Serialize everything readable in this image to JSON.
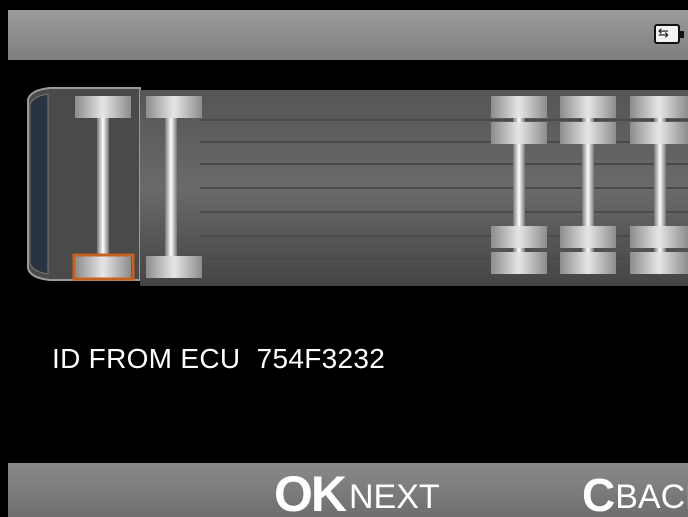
{
  "header": {
    "battery_icon": "battery-icon"
  },
  "vehicle": {
    "diagram": "truck-top-view",
    "selected_wheel": "front-left",
    "colors": {
      "highlight": "#c8601e",
      "wheel": "#cfcfcf",
      "body": "#5a5a5a"
    }
  },
  "status": {
    "label": "ID FROM ECU",
    "value": "754F3232"
  },
  "footer": {
    "ok_key": "OK",
    "ok_label": "NEXT",
    "back_key": "C",
    "back_label": "BACK"
  }
}
